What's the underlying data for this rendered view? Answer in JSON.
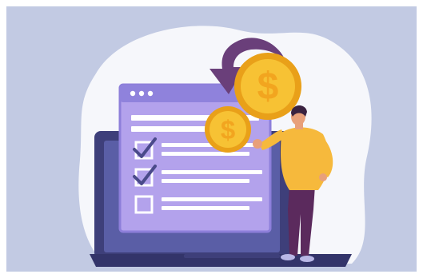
{
  "colors": {
    "background": "#c2cae3",
    "blob": "#f6f7fb",
    "laptop_body": "#3e3f7a",
    "laptop_screen": "#5a5ea6",
    "laptop_base": "#33346a",
    "window_fill": "#b3a2ec",
    "window_border": "#8d7fda",
    "window_header": "#8f82dc",
    "lines": "#ffffff",
    "check": "#4a4a8a",
    "coin": "#f7c234",
    "coin_edge": "#e9a019",
    "coin_symbol": "#f2a51f",
    "arrow": "#6a3f7a",
    "shirt": "#f6b93c",
    "pants": "#5b2a5d",
    "skin": "#e8a07a",
    "hair": "#3a2240",
    "shoes": "#b9b7e6"
  },
  "checklist": {
    "items": [
      {
        "checked": true
      },
      {
        "checked": true
      },
      {
        "checked": false
      }
    ]
  },
  "coins": [
    {
      "symbol": "$",
      "size": "large"
    },
    {
      "symbol": "$",
      "size": "small"
    }
  ],
  "icons": [
    "dollar-coin-icon",
    "refund-arrow-icon",
    "checkbox-icon",
    "checkmark-icon"
  ]
}
